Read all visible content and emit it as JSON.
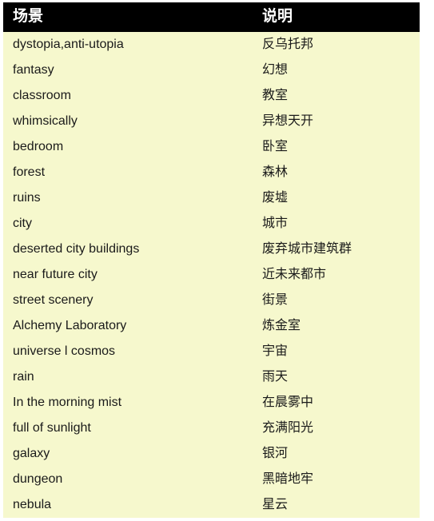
{
  "table": {
    "headers": [
      {
        "label": "场景"
      },
      {
        "label": "说明"
      }
    ],
    "rows": [
      {
        "scene": "dystopia,anti-utopia",
        "description": "反乌托邦"
      },
      {
        "scene": "fantasy",
        "description": "幻想"
      },
      {
        "scene": "classroom",
        "description": "教室"
      },
      {
        "scene": "whimsically",
        "description": "异想天开"
      },
      {
        "scene": "bedroom",
        "description": "卧室"
      },
      {
        "scene": "forest",
        "description": "森林"
      },
      {
        "scene": "ruins",
        "description": "废墟"
      },
      {
        "scene": "city",
        "description": "城市"
      },
      {
        "scene": "deserted city buildings",
        "description": "废弃城市建筑群"
      },
      {
        "scene": "near future city",
        "description": "近未来都市"
      },
      {
        "scene": "street scenery",
        "description": "街景"
      },
      {
        "scene": "Alchemy Laboratory",
        "description": "炼金室"
      },
      {
        "scene": "universe l cosmos",
        "description": "宇宙"
      },
      {
        "scene": "rain",
        "description": "雨天"
      },
      {
        "scene": "In the morning mist",
        "description": "在晨雾中"
      },
      {
        "scene": "full of sunlight",
        "description": "充满阳光"
      },
      {
        "scene": "galaxy",
        "description": "银河"
      },
      {
        "scene": "dungeon",
        "description": "黑暗地牢"
      },
      {
        "scene": "nebula",
        "description": "星云"
      }
    ]
  },
  "colors": {
    "header_background": "#000000",
    "header_text": "#ffffff",
    "row_background": "#f6f8cd",
    "row_text": "#1a1a1a",
    "page_background": "#ffffff"
  }
}
